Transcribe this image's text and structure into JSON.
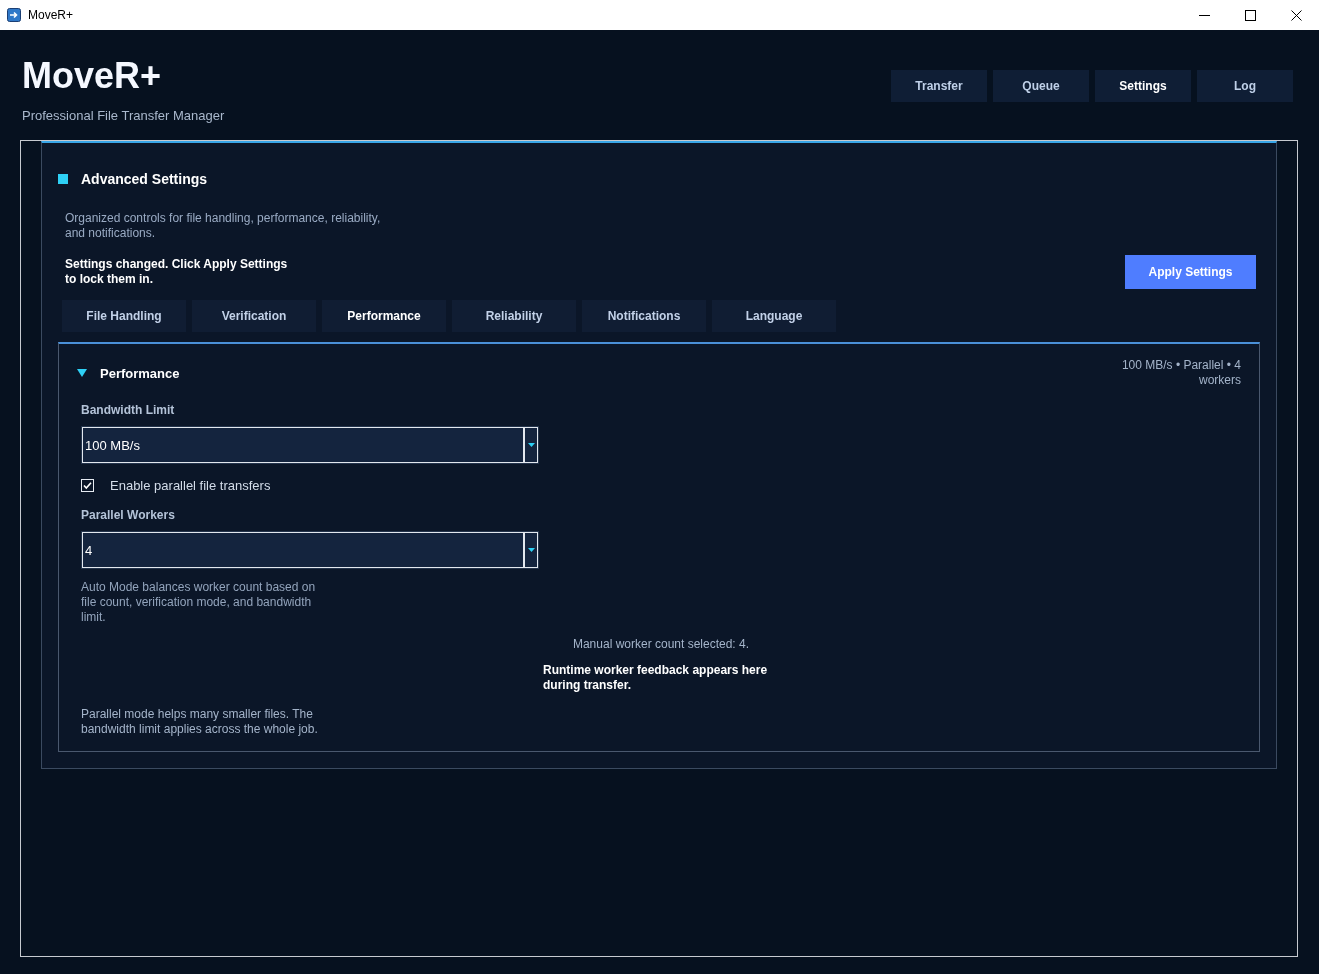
{
  "window": {
    "title": "MoveR+"
  },
  "header": {
    "title": "MoveR+",
    "subtitle": "Professional File Transfer Manager"
  },
  "nav": [
    {
      "label": "Transfer",
      "selected": false
    },
    {
      "label": "Queue",
      "selected": false
    },
    {
      "label": "Settings",
      "selected": true
    },
    {
      "label": "Log",
      "selected": false
    }
  ],
  "advanced_settings": {
    "title": "Advanced Settings",
    "description": "Organized controls for file handling, performance, reliability, and notifications.",
    "notice": "Settings changed. Click Apply Settings to lock them in.",
    "apply_button": "Apply Settings",
    "tabs": [
      {
        "label": "File Handling",
        "selected": false
      },
      {
        "label": "Verification",
        "selected": false
      },
      {
        "label": "Performance",
        "selected": true
      },
      {
        "label": "Reliability",
        "selected": false
      },
      {
        "label": "Notifications",
        "selected": false
      },
      {
        "label": "Language",
        "selected": false
      }
    ],
    "section": {
      "title": "Performance",
      "expanded": true,
      "summary": "100 MB/s • Parallel • 4 workers",
      "fields": [
        {
          "kind": "combo",
          "label": "Bandwidth Limit",
          "value": "100 MB/s"
        },
        {
          "kind": "checkbox",
          "label": "Enable parallel file transfers",
          "checked": true
        },
        {
          "kind": "combo",
          "label": "Parallel Workers",
          "value": "4"
        },
        {
          "kind": "help",
          "text": "Auto Mode balances worker count based on file count, verification mode, and bandwidth limit."
        }
      ],
      "worker_status": "Manual worker count selected: 4.",
      "runtime_feedback": "Runtime worker feedback appears here during transfer.",
      "footnote": "Parallel mode helps many smaller files. The bandwidth limit applies across the whole job."
    }
  }
}
